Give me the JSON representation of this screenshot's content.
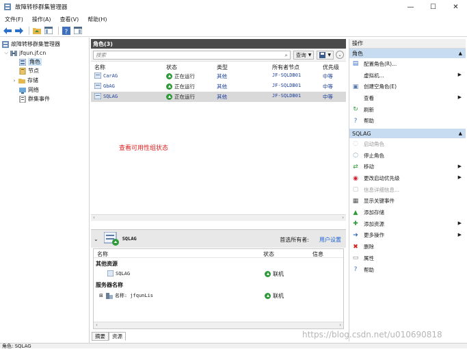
{
  "window": {
    "title": "故障转移群集管理器"
  },
  "window_controls": {
    "minimize": "—",
    "maximize": "☐",
    "close": "✕"
  },
  "menu": [
    "文件(F)",
    "操作(A)",
    "查看(V)",
    "帮助(H)"
  ],
  "tree": {
    "root": "故障转移群集管理器",
    "cluster": "jfqun.jf.cn",
    "children": [
      "角色",
      "节点",
      "存储",
      "网络",
      "群集事件"
    ],
    "selected": "角色"
  },
  "center": {
    "header": "角色(3)",
    "search_placeholder": "搜索",
    "query_button": "查询",
    "columns": [
      "名称",
      "状态",
      "类型",
      "所有者节点",
      "优先级"
    ],
    "rows": [
      {
        "name": "CarAG",
        "status": "正在运行",
        "type": "其他",
        "owner": "JF-SQLDB01",
        "priority": "中等"
      },
      {
        "name": "GbAG",
        "status": "正在运行",
        "type": "其他",
        "owner": "JF-SQLDB01",
        "priority": "中等"
      },
      {
        "name": "SQLAG",
        "status": "正在运行",
        "type": "其他",
        "owner": "JF-SQLDB01",
        "priority": "中等"
      }
    ],
    "selected_row": "SQLAG",
    "annotation": "查看可用性组状态"
  },
  "detail": {
    "name": "SQLAG",
    "preferred_owner_label": "首选所有者:",
    "preferred_owner_link": "用户设置",
    "columns": [
      "名称",
      "状态",
      "信息"
    ],
    "groups": [
      {
        "title": "其他资源",
        "items": [
          {
            "name": "SQLAG",
            "status": "联机"
          }
        ]
      },
      {
        "title": "服务器名称",
        "items": [
          {
            "name": "名称: jfqunLis",
            "status": "联机"
          }
        ]
      }
    ],
    "tabs": [
      "摘要",
      "资源"
    ],
    "active_tab": "资源"
  },
  "actions": {
    "title": "操作",
    "sections": [
      {
        "name": "角色",
        "items": [
          {
            "label": "配置角色(R)...",
            "icon": "configure-role-icon",
            "submenu": false,
            "disabled": false
          },
          {
            "label": "虚拟机...",
            "icon": "blank",
            "submenu": true,
            "disabled": false
          },
          {
            "label": "创建空角色(E)",
            "icon": "empty-role-icon",
            "submenu": false,
            "disabled": false
          },
          {
            "label": "查看",
            "icon": "blank",
            "submenu": true,
            "disabled": false
          },
          {
            "label": "刷新",
            "icon": "refresh-icon",
            "submenu": false,
            "disabled": false
          },
          {
            "label": "帮助",
            "icon": "help-icon",
            "submenu": false,
            "disabled": false
          }
        ]
      },
      {
        "name": "SQLAG",
        "items": [
          {
            "label": "启动角色",
            "icon": "start-role-icon",
            "submenu": false,
            "disabled": true
          },
          {
            "label": "停止角色",
            "icon": "stop-role-icon",
            "submenu": false,
            "disabled": false
          },
          {
            "label": "移动",
            "icon": "move-icon",
            "submenu": true,
            "disabled": false
          },
          {
            "label": "更改启动优先级",
            "icon": "priority-icon",
            "submenu": true,
            "disabled": false
          },
          {
            "label": "信息详细信息...",
            "icon": "info-details-icon",
            "submenu": false,
            "disabled": true
          },
          {
            "label": "显示关键事件",
            "icon": "critical-events-icon",
            "submenu": false,
            "disabled": false
          },
          {
            "label": "添加存储",
            "icon": "add-storage-icon",
            "submenu": false,
            "disabled": false
          },
          {
            "label": "添加资源",
            "icon": "add-resource-icon",
            "submenu": true,
            "disabled": false
          },
          {
            "label": "更多操作",
            "icon": "more-actions-icon",
            "submenu": true,
            "disabled": false
          },
          {
            "label": "删除",
            "icon": "delete-icon",
            "submenu": false,
            "disabled": false
          },
          {
            "label": "属性",
            "icon": "properties-icon",
            "submenu": false,
            "disabled": false
          },
          {
            "label": "帮助",
            "icon": "help-icon",
            "submenu": false,
            "disabled": false
          }
        ]
      }
    ]
  },
  "statusbar": "角色: SQLAG",
  "watermark": "https://blog.csdn.net/u010690818",
  "colors": {
    "accent_section": "#c7dcf0",
    "header_dark": "#4a4a4a",
    "annotation_red": "#e02020",
    "link_blue": "#1a5fd0"
  }
}
